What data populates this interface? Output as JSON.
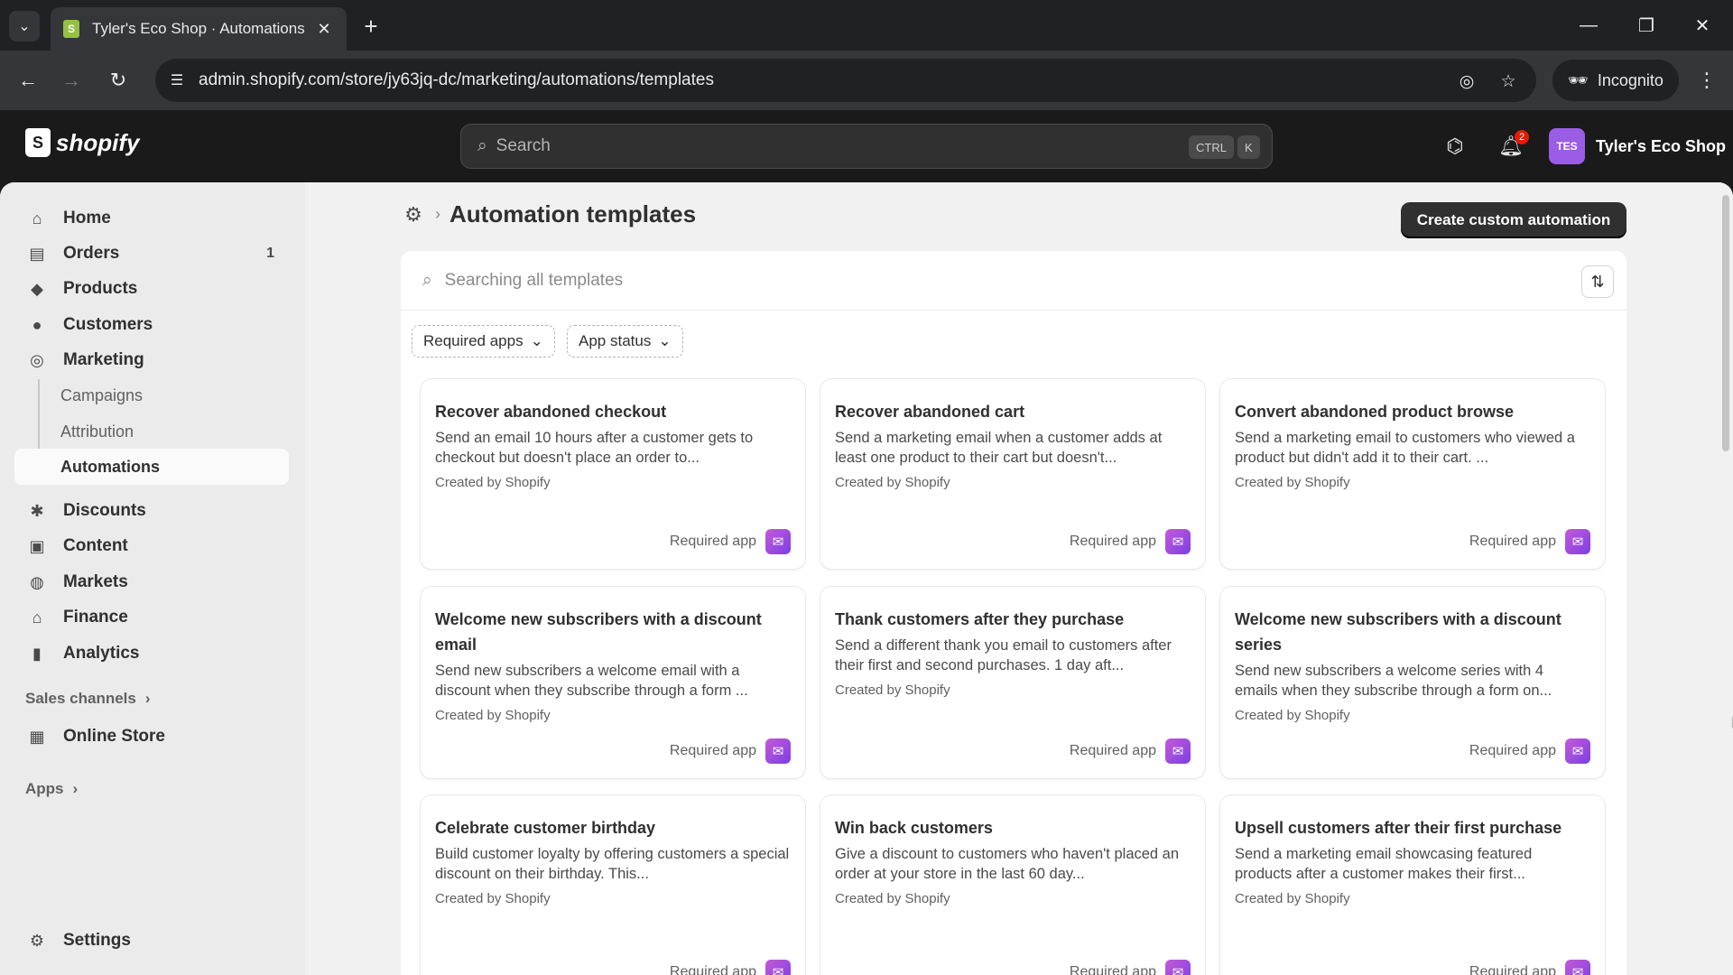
{
  "browser": {
    "tab_title": "Tyler's Eco Shop · Automations",
    "url": "admin.shopify.com/store/jy63jq-dc/marketing/automations/templates",
    "incognito_label": "Incognito"
  },
  "topbar": {
    "logo_text": "shopify",
    "search_placeholder": "Search",
    "shortcut_ctrl": "CTRL",
    "shortcut_key": "K",
    "notification_count": "2",
    "store_initials": "TES",
    "store_name": "Tyler's Eco Shop"
  },
  "sidebar": {
    "items": [
      {
        "label": "Home",
        "icon": "home-icon"
      },
      {
        "label": "Orders",
        "icon": "orders-icon",
        "count": "1"
      },
      {
        "label": "Products",
        "icon": "tag-icon"
      },
      {
        "label": "Customers",
        "icon": "person-icon"
      },
      {
        "label": "Marketing",
        "icon": "target-icon"
      }
    ],
    "marketing_sub": [
      "Campaigns",
      "Attribution",
      "Automations"
    ],
    "items2": [
      {
        "label": "Discounts",
        "icon": "discount-icon"
      },
      {
        "label": "Content",
        "icon": "content-icon"
      },
      {
        "label": "Markets",
        "icon": "globe-icon"
      },
      {
        "label": "Finance",
        "icon": "bank-icon"
      },
      {
        "label": "Analytics",
        "icon": "chart-icon"
      }
    ],
    "sales_channels_label": "Sales channels",
    "online_store_label": "Online Store",
    "apps_label": "Apps",
    "settings_label": "Settings"
  },
  "page": {
    "title": "Automation templates",
    "primary_button": "Create custom automation",
    "search_placeholder": "Searching all templates",
    "filters": [
      "Required apps",
      "App status"
    ]
  },
  "cards": [
    {
      "title": "Recover abandoned checkout",
      "desc": "Send an email 10 hours after a customer gets to checkout but doesn't place an order to...",
      "by": "Created by Shopify",
      "req": "Required app"
    },
    {
      "title": "Recover abandoned cart",
      "desc": "Send a marketing email when a customer adds at least one product to their cart but doesn't...",
      "by": "Created by Shopify",
      "req": "Required app"
    },
    {
      "title": "Convert abandoned product browse",
      "desc": "Send a marketing email to customers who viewed a product but didn't add it to their cart. ...",
      "by": "Created by Shopify",
      "req": "Required app"
    },
    {
      "title": "Welcome new subscribers with a discount email",
      "desc": "Send new subscribers a welcome email with a discount when they subscribe through a form ...",
      "by": "Created by Shopify",
      "req": "Required app"
    },
    {
      "title": "Thank customers after they purchase",
      "desc": "Send a different thank you email to customers after their first and second purchases. 1 day aft...",
      "by": "Created by Shopify",
      "req": "Required app"
    },
    {
      "title": "Welcome new subscribers with a discount series",
      "desc": "Send new subscribers a welcome series with 4 emails when they subscribe through a form on...",
      "by": "Created by Shopify",
      "req": "Required app"
    },
    {
      "title": "Celebrate customer birthday",
      "desc": "Build customer loyalty by offering customers a special discount on their birthday. This...",
      "by": "Created by Shopify",
      "req": "Required app"
    },
    {
      "title": "Win back customers",
      "desc": "Give a discount to customers who haven't placed an order at your store in the last 60 day...",
      "by": "Created by Shopify",
      "req": "Required app"
    },
    {
      "title": "Upsell customers after their first purchase",
      "desc": "Send a marketing email showcasing featured products after a customer makes their first...",
      "by": "Created by Shopify",
      "req": "Required app"
    }
  ]
}
